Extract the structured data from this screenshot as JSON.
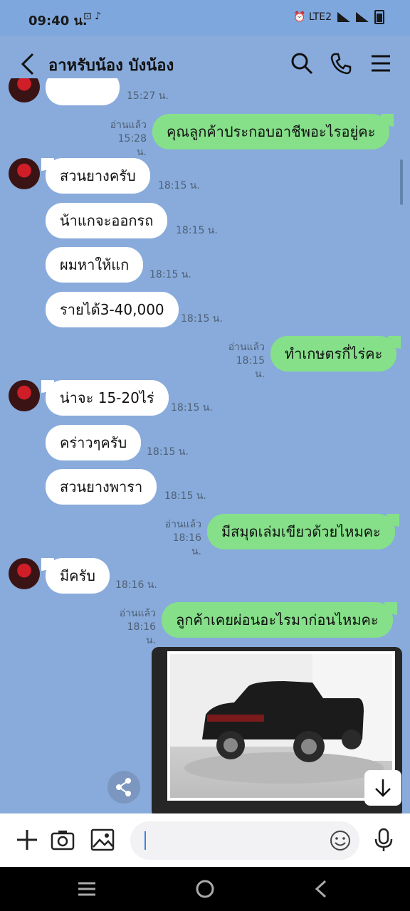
{
  "status": {
    "time": "09:40 น.",
    "left_icons": "⊡ ♪",
    "right_icons": "⏰ LTE2"
  },
  "header": {
    "title": "อาหรับน้อง บังน้อง"
  },
  "messages": [
    {
      "id": "m0",
      "dir": "in",
      "text": "",
      "time": "15:27 น."
    },
    {
      "id": "m1",
      "dir": "out",
      "text": "คุณลูกค้าประกอบอาชีพอะไรอยู่คะ",
      "read": "อ่านแล้ว",
      "time": "15:28 น."
    },
    {
      "id": "m2",
      "dir": "in",
      "text": "สวนยางครับ",
      "time": "18:15 น."
    },
    {
      "id": "m3",
      "dir": "in",
      "text": "น้าแกจะออกรถ",
      "time": "18:15 น."
    },
    {
      "id": "m4",
      "dir": "in",
      "text": "ผมหาให้แก",
      "time": "18:15 น."
    },
    {
      "id": "m5",
      "dir": "in",
      "text": "รายได้3-40,000",
      "time": "18:15 น."
    },
    {
      "id": "m6",
      "dir": "out",
      "text": "ทำเกษตรกี่ไร่คะ",
      "read": "อ่านแล้ว",
      "time": "18:15 น."
    },
    {
      "id": "m7",
      "dir": "in",
      "text": "น่าจะ 15-20ไร่",
      "time": "18:15 น."
    },
    {
      "id": "m8",
      "dir": "in",
      "text": "คร่าวๆครับ",
      "time": "18:15 น."
    },
    {
      "id": "m9",
      "dir": "in",
      "text": "สวนยางพารา",
      "time": "18:15 น."
    },
    {
      "id": "m10",
      "dir": "out",
      "text": "มีสมุดเล่มเขียวด้วยไหมคะ",
      "read": "อ่านแล้ว",
      "time": "18:16 น."
    },
    {
      "id": "m11",
      "dir": "in",
      "text": "มีครับ",
      "time": "18:16 น."
    },
    {
      "id": "m12",
      "dir": "out",
      "text": "ลูกค้าเคยผ่อนอะไรมาก่อนไหมคะ",
      "read": "อ่านแล้ว",
      "time": "18:16 น."
    }
  ],
  "image_message": {
    "icon": "car-photo"
  },
  "composer": {
    "placeholder": ""
  }
}
